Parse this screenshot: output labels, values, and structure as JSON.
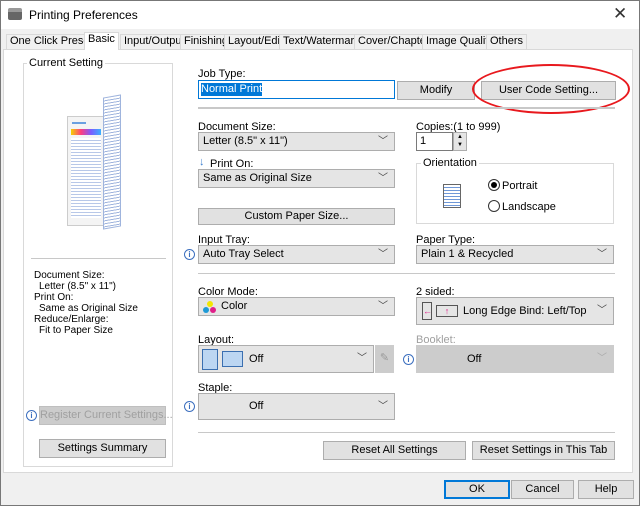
{
  "window": {
    "title": "Printing Preferences",
    "close_icon": "close-icon"
  },
  "tabs": [
    {
      "label": "One Click Presets"
    },
    {
      "label": "Basic",
      "selected": true
    },
    {
      "label": "Input/Output"
    },
    {
      "label": "Finishing"
    },
    {
      "label": "Layout/Edit"
    },
    {
      "label": "Text/Watermark"
    },
    {
      "label": "Cover/Chapter"
    },
    {
      "label": "Image Quality"
    },
    {
      "label": "Others"
    }
  ],
  "current_setting": {
    "title": "Current Setting",
    "summary": [
      "Document Size:",
      "Letter (8.5\" x 11\")",
      "Print On:",
      "Same as Original Size",
      "Reduce/Enlarge:",
      "Fit to Paper Size"
    ],
    "register_label": "Register Current Settings...",
    "summary_label": "Settings Summary"
  },
  "job_type": {
    "label": "Job Type:",
    "value": "Normal Print",
    "modify_label": "Modify",
    "user_code_label": "User Code Setting...",
    "highlight_color": "#e8191e"
  },
  "document_size": {
    "label": "Document Size:",
    "value": "Letter (8.5\" x 11\")"
  },
  "copies": {
    "label": "Copies:(1 to 999)",
    "value": "1"
  },
  "print_on": {
    "label": "Print On:",
    "value": "Same as Original Size"
  },
  "orientation": {
    "title": "Orientation",
    "portrait": "Portrait",
    "landscape": "Landscape",
    "selected": "Portrait"
  },
  "custom_paper_label": "Custom Paper Size...",
  "input_tray": {
    "label": "Input Tray:",
    "value": "Auto Tray Select"
  },
  "paper_type": {
    "label": "Paper Type:",
    "value": "Plain 1 & Recycled"
  },
  "color_mode": {
    "label": "Color Mode:",
    "value": "Color"
  },
  "two_sided": {
    "label": "2 sided:",
    "value": "Long Edge Bind: Left/Top"
  },
  "layout": {
    "label": "Layout:",
    "value": "Off"
  },
  "booklet": {
    "label": "Booklet:",
    "value": "Off",
    "disabled": true
  },
  "staple": {
    "label": "Staple:",
    "value": "Off"
  },
  "reset_all_label": "Reset All Settings",
  "reset_tab_label": "Reset Settings in This Tab",
  "footer": {
    "ok": "OK",
    "cancel": "Cancel",
    "help": "Help"
  }
}
